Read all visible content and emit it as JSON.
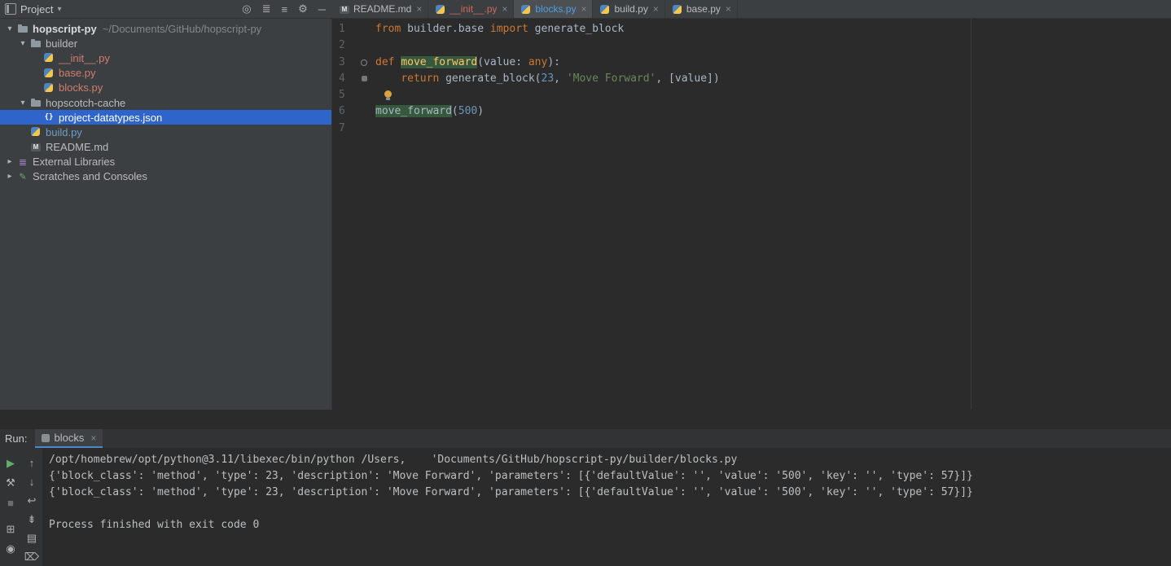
{
  "toolbar": {
    "project_label": "Project",
    "icons": [
      {
        "name": "locate-file-icon",
        "glyph": "◎"
      },
      {
        "name": "expand-all-icon",
        "glyph": "≣"
      },
      {
        "name": "collapse-all-icon",
        "glyph": "≡"
      },
      {
        "name": "settings-gear-icon",
        "glyph": "⚙"
      },
      {
        "name": "hide-panel-icon",
        "glyph": "─"
      }
    ]
  },
  "icons": {
    "close": "×",
    "chevron_down": "▾",
    "chevron_right": "▸"
  },
  "project_tree": {
    "items": [
      {
        "label": "hopscript-py",
        "sublabel": "~/Documents/GitHub/hopscript-py",
        "type": "folder",
        "level": 0,
        "chevron": "down",
        "bold": true
      },
      {
        "label": "builder",
        "type": "folder",
        "level": 1,
        "chevron": "down"
      },
      {
        "label": "__init__.py",
        "type": "python",
        "level": 2,
        "color": "#cf7e6e"
      },
      {
        "label": "base.py",
        "type": "python",
        "level": 2,
        "color": "#cf7e6e"
      },
      {
        "label": "blocks.py",
        "type": "python",
        "level": 2,
        "color": "#cf7e6e"
      },
      {
        "label": "hopscotch-cache",
        "type": "folder",
        "level": 1,
        "chevron": "down"
      },
      {
        "label": "project-datatypes.json",
        "type": "json",
        "level": 2,
        "selected": true
      },
      {
        "label": "build.py",
        "type": "python",
        "level": 1,
        "color": "#6d9dc5"
      },
      {
        "label": "README.md",
        "type": "markdown",
        "level": 1
      },
      {
        "label": "External Libraries",
        "type": "library",
        "level": 0,
        "chevron": "right"
      },
      {
        "label": "Scratches and Consoles",
        "type": "scratch",
        "level": 0,
        "chevron": "right"
      }
    ]
  },
  "editor_tabs": [
    {
      "label": "README.md",
      "type": "markdown",
      "color": "#bbbbbb",
      "active": false
    },
    {
      "label": "__init__.py",
      "type": "python",
      "color": "#d1675a",
      "active": false
    },
    {
      "label": "blocks.py",
      "type": "python",
      "color": "#4f9ee3",
      "active": true
    },
    {
      "label": "build.py",
      "type": "python",
      "color": "#bbbbbb",
      "active": false
    },
    {
      "label": "base.py",
      "type": "python",
      "color": "#bbbbbb",
      "active": false
    }
  ],
  "editor": {
    "palette": {
      "k": "#cc7832",
      "p": "#a9b7c6",
      "s": "#6a8759",
      "n": "#6897bb",
      "f": "#ffc66b",
      "hl_bg": "#36583c",
      "line_number": "#606366",
      "editor_bg": "#2b2b2b",
      "selection_bg": "#2f65ca"
    },
    "lines": [
      {
        "num": "1",
        "segs": [
          {
            "t": "from",
            "c": "k"
          },
          {
            "t": " builder.base ",
            "c": "p"
          },
          {
            "t": "import",
            "c": "k"
          },
          {
            "t": " generate_block",
            "c": "p"
          }
        ]
      },
      {
        "num": "2",
        "segs": []
      },
      {
        "num": "3",
        "marker": "o",
        "segs": [
          {
            "t": "def ",
            "c": "k"
          },
          {
            "t": "move_forward",
            "c": "f",
            "hl": true
          },
          {
            "t": "(value: ",
            "c": "p"
          },
          {
            "t": "any",
            "c": "k"
          },
          {
            "t": "):",
            "c": "p"
          }
        ]
      },
      {
        "num": "4",
        "marker": "s",
        "segs": [
          {
            "t": "    ",
            "c": "p"
          },
          {
            "t": "return",
            "c": "k"
          },
          {
            "t": " generate_block(",
            "c": "p"
          },
          {
            "t": "23",
            "c": "n"
          },
          {
            "t": ", ",
            "c": "p"
          },
          {
            "t": "'Move Forward'",
            "c": "s"
          },
          {
            "t": ", [value])",
            "c": "p"
          }
        ]
      },
      {
        "num": "5",
        "bulb": true,
        "segs": []
      },
      {
        "num": "6",
        "segs": [
          {
            "t": "move_forward",
            "c": "p",
            "hl": true
          },
          {
            "t": "(",
            "c": "p"
          },
          {
            "t": "500",
            "c": "n"
          },
          {
            "t": ")",
            "c": "p"
          }
        ]
      },
      {
        "num": "7",
        "segs": []
      }
    ]
  },
  "run_panel": {
    "label": "Run:",
    "tab": {
      "label": "blocks"
    },
    "toolbar_primary": [
      {
        "name": "rerun-button",
        "glyph": "▶",
        "color": "#5fad65"
      },
      {
        "name": "wrench-icon",
        "glyph": "⚒",
        "color": "#afb1b3"
      },
      {
        "name": "stop-button",
        "glyph": "■",
        "color": "#6b6e70"
      },
      {
        "name": "restore-layout-icon",
        "glyph": "⊞",
        "color": "#afb1b3",
        "gap": true
      },
      {
        "name": "pin-icon",
        "glyph": "◉",
        "color": "#afb1b3"
      }
    ],
    "toolbar_secondary": [
      {
        "name": "prev-occurrence-icon",
        "glyph": "↑",
        "color": "#afb1b3"
      },
      {
        "name": "next-occurrence-icon",
        "glyph": "↓",
        "color": "#afb1b3"
      },
      {
        "name": "soft-wrap-icon",
        "glyph": "↩",
        "color": "#afb1b3"
      },
      {
        "name": "scroll-to-end-icon",
        "glyph": "⇟",
        "color": "#afb1b3"
      },
      {
        "name": "print-icon",
        "glyph": "▤",
        "color": "#afb1b3"
      },
      {
        "name": "clear-all-icon",
        "glyph": "⌦",
        "color": "#afb1b3"
      }
    ],
    "console_lines": [
      "/opt/homebrew/opt/python@3.11/libexec/bin/python /Users,    'Documents/GitHub/hopscript-py/builder/blocks.py",
      "{'block_class': 'method', 'type': 23, 'description': 'Move Forward', 'parameters': [{'defaultValue': '', 'value': '500', 'key': '', 'type': 57}]}",
      "{'block_class': 'method', 'type': 23, 'description': 'Move Forward', 'parameters': [{'defaultValue': '', 'value': '500', 'key': '', 'type': 57}]}",
      "",
      "Process finished with exit code 0"
    ]
  }
}
